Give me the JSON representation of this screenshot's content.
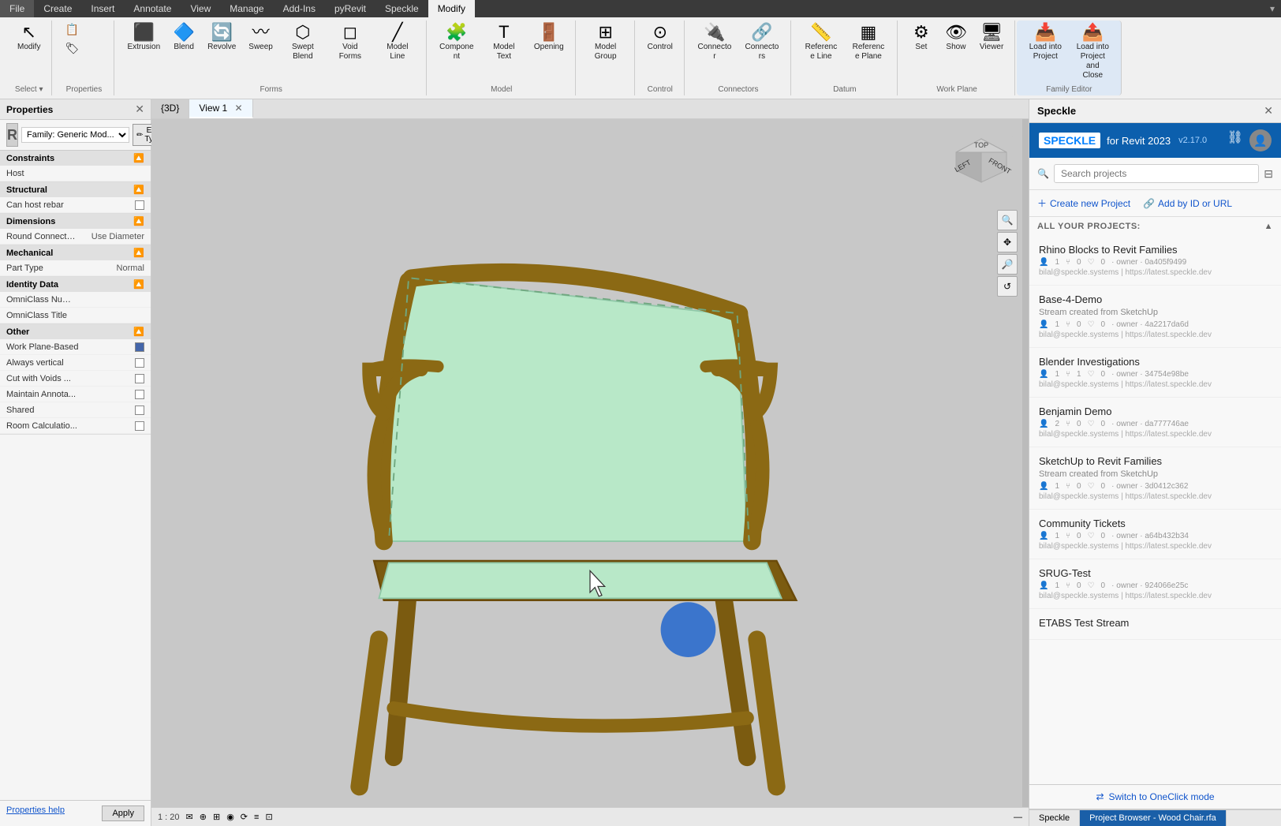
{
  "ribbon": {
    "tabs": [
      "File",
      "Create",
      "Insert",
      "Annotate",
      "View",
      "Manage",
      "Add-Ins",
      "pyRevit",
      "Speckle",
      "Modify"
    ],
    "active_tab": "Modify",
    "groups": [
      {
        "name": "select",
        "label": "Select ▾",
        "buttons": []
      },
      {
        "name": "properties",
        "label": "Properties",
        "buttons": []
      },
      {
        "name": "forms",
        "label": "Forms",
        "buttons": [
          "Extrusion",
          "Blend",
          "Revolve",
          "Sweep",
          "Swept Blend",
          "Void Forms",
          "Model Line"
        ]
      },
      {
        "name": "model",
        "label": "Model",
        "buttons": [
          "Component",
          "Model Text",
          "Opening"
        ]
      },
      {
        "name": "model-group",
        "label": "",
        "buttons": [
          "Model Group"
        ]
      },
      {
        "name": "control",
        "label": "Control",
        "buttons": [
          "Control"
        ]
      },
      {
        "name": "connectors",
        "label": "Connectors",
        "buttons": [
          "Connector",
          "Connectors"
        ]
      },
      {
        "name": "datum",
        "label": "Datum",
        "buttons": [
          "Reference Line",
          "Reference Plane"
        ]
      },
      {
        "name": "work-plane",
        "label": "Work Plane",
        "buttons": [
          "Set",
          "Show",
          "Viewer"
        ]
      },
      {
        "name": "family-editor",
        "label": "Family Editor",
        "buttons": [
          "Load into Project",
          "Load into Project and Close"
        ]
      }
    ]
  },
  "left_panel": {
    "title": "Properties",
    "family_name": "Family: Generic Mod...",
    "family_icon": "R",
    "edit_type_label": "Edit Type",
    "sections": [
      {
        "name": "Constraints",
        "rows": [
          {
            "label": "Host",
            "value": "",
            "type": "text"
          }
        ]
      },
      {
        "name": "Structural",
        "rows": [
          {
            "label": "Can host rebar",
            "value": false,
            "type": "checkbox"
          }
        ]
      },
      {
        "name": "Dimensions",
        "rows": [
          {
            "label": "Round Connecto...",
            "value": "Use Diameter",
            "type": "text"
          }
        ]
      },
      {
        "name": "Mechanical",
        "rows": [
          {
            "label": "Part Type",
            "value": "Normal",
            "type": "text"
          }
        ]
      },
      {
        "name": "Identity Data",
        "rows": [
          {
            "label": "OmniClass Num...",
            "value": "",
            "type": "text"
          },
          {
            "label": "OmniClass Title",
            "value": "",
            "type": "text"
          }
        ]
      },
      {
        "name": "Other",
        "rows": [
          {
            "label": "Work Plane-Based",
            "value": true,
            "type": "checkbox"
          },
          {
            "label": "Always vertical",
            "value": false,
            "type": "checkbox"
          },
          {
            "label": "Cut with Voids ...",
            "value": false,
            "type": "checkbox"
          },
          {
            "label": "Maintain Annota...",
            "value": false,
            "type": "checkbox"
          },
          {
            "label": "Shared",
            "value": false,
            "type": "checkbox"
          },
          {
            "label": "Room Calculatio...",
            "value": false,
            "type": "checkbox"
          }
        ]
      }
    ],
    "footer": {
      "help_link": "Properties help",
      "apply_btn": "Apply"
    }
  },
  "viewport": {
    "tabs": [
      {
        "label": "{3D}",
        "active": true,
        "closable": false
      },
      {
        "label": "View 1",
        "active": false,
        "closable": true
      }
    ],
    "scale": "1 : 20",
    "status_icons": [
      "✉",
      "⊕",
      "⊞",
      "◉",
      "✦",
      "↺",
      "≡",
      "⌖"
    ]
  },
  "speckle": {
    "title": "Speckle",
    "logo": "SPECKLE",
    "for_text": "for Revit 2023",
    "version": "v2.17.0",
    "search_placeholder": "Search projects",
    "actions": [
      {
        "label": "Create new Project",
        "icon": "+"
      },
      {
        "label": "Add by ID or URL",
        "icon": "🔗"
      }
    ],
    "projects_header": "ALL YOUR PROJECTS:",
    "projects": [
      {
        "name": "Rhino Blocks to Revit Families",
        "subtitle": "",
        "meta": "1 person • 0 likes • 0 comments • owner • 0a405f9499",
        "url": "bilal@speckle.systems | https://latest.speckle.dev"
      },
      {
        "name": "Base-4-Demo",
        "subtitle": "Stream created from SketchUp",
        "meta": "1 person • 0 likes • 0 comments • owner • 4a2217da6d",
        "url": "bilal@speckle.systems | https://latest.speckle.dev"
      },
      {
        "name": "Blender Investigations",
        "subtitle": "",
        "meta": "1 person • 1 like • 0 comments • owner • 34754e98be",
        "url": "bilal@speckle.systems | https://latest.speckle.dev"
      },
      {
        "name": "Benjamin Demo",
        "subtitle": "",
        "meta": "2 persons • 0 likes • 0 comments • owner • da777746ae",
        "url": "bilal@speckle.systems | https://latest.speckle.dev"
      },
      {
        "name": "SketchUp to Revit Families",
        "subtitle": "Stream created from SketchUp",
        "meta": "1 person • 0 likes • 0 comments • owner • 3d0412c362",
        "url": "bilal@speckle.systems | https://latest.speckle.dev"
      },
      {
        "name": "Community Tickets",
        "subtitle": "",
        "meta": "1 person • 0 likes • 0 comments • owner • a64b432b34",
        "url": "bilal@speckle.systems | https://latest.speckle.dev"
      },
      {
        "name": "SRUG-Test",
        "subtitle": "",
        "meta": "1 person • 0 likes • 0 comments • owner • 924066e25c",
        "url": "bilal@speckle.systems | https://latest.speckle.dev"
      },
      {
        "name": "ETABS Test Stream",
        "subtitle": "",
        "meta": "",
        "url": ""
      }
    ],
    "footer": {
      "switch_mode": "Switch to OneClick mode"
    },
    "bottom_tabs": [
      "Speckle",
      "Project Browser - Wood Chair.rfa"
    ]
  }
}
